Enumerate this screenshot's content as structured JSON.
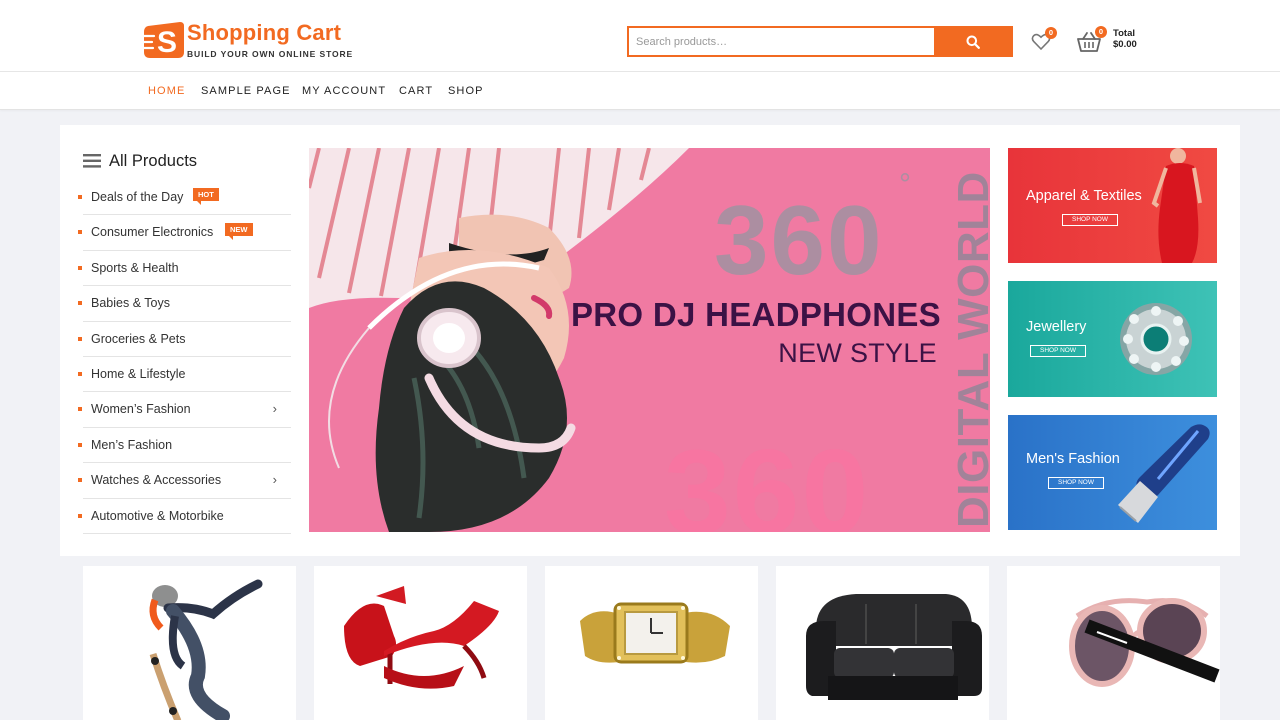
{
  "site": {
    "logo_letter": "S",
    "title": "Shopping Cart",
    "tagline": "BUILD YOUR OWN ONLINE STORE",
    "accent_color": "#f26a21"
  },
  "search": {
    "placeholder": "Search products…",
    "button_icon": "search-icon"
  },
  "wishlist": {
    "icon": "heart-icon",
    "count": "0"
  },
  "cart": {
    "icon": "basket-icon",
    "count": "0",
    "total_label": "Total",
    "total_value": "$0.00"
  },
  "nav": {
    "items": [
      {
        "label": "HOME",
        "active": true
      },
      {
        "label": "SAMPLE PAGE"
      },
      {
        "label": "MY ACCOUNT"
      },
      {
        "label": "CART"
      },
      {
        "label": "SHOP"
      }
    ]
  },
  "categories": {
    "heading": "All Products",
    "icon": "menu-icon",
    "items": [
      {
        "label": "Deals of the Day",
        "tag": "HOT"
      },
      {
        "label": "Consumer Electronics",
        "tag": "NEW"
      },
      {
        "label": "Sports & Health"
      },
      {
        "label": "Babies & Toys"
      },
      {
        "label": "Groceries & Pets"
      },
      {
        "label": "Home & Lifestyle"
      },
      {
        "label": "Women’s Fashion",
        "submenu": "›"
      },
      {
        "label": "Men’s Fashion"
      },
      {
        "label": "Watches & Accessories",
        "submenu": "›"
      },
      {
        "label": "Automotive & Motorbike"
      }
    ]
  },
  "hero": {
    "big_number": "360",
    "degree": "°",
    "ghost_number": "360",
    "vertical_text": "DIGITAL WORLD",
    "title": "PRO DJ HEADPHONES",
    "subtitle": "NEW STYLE",
    "background": "#f07aa2"
  },
  "promos": [
    {
      "title": "Apparel & Textiles",
      "button": "SHOP NOW",
      "color": "#e8343a"
    },
    {
      "title": "Jewellery",
      "button": "SHOP NOW",
      "color": "#1ba89a"
    },
    {
      "title": "Men's Fashion",
      "button": "SHOP NOW",
      "color": "#2e7fd0"
    }
  ],
  "products": [
    {
      "image": "skateboarder"
    },
    {
      "image": "red-heels"
    },
    {
      "image": "gold-watch"
    },
    {
      "image": "black-sofa"
    },
    {
      "image": "sunglasses"
    }
  ]
}
